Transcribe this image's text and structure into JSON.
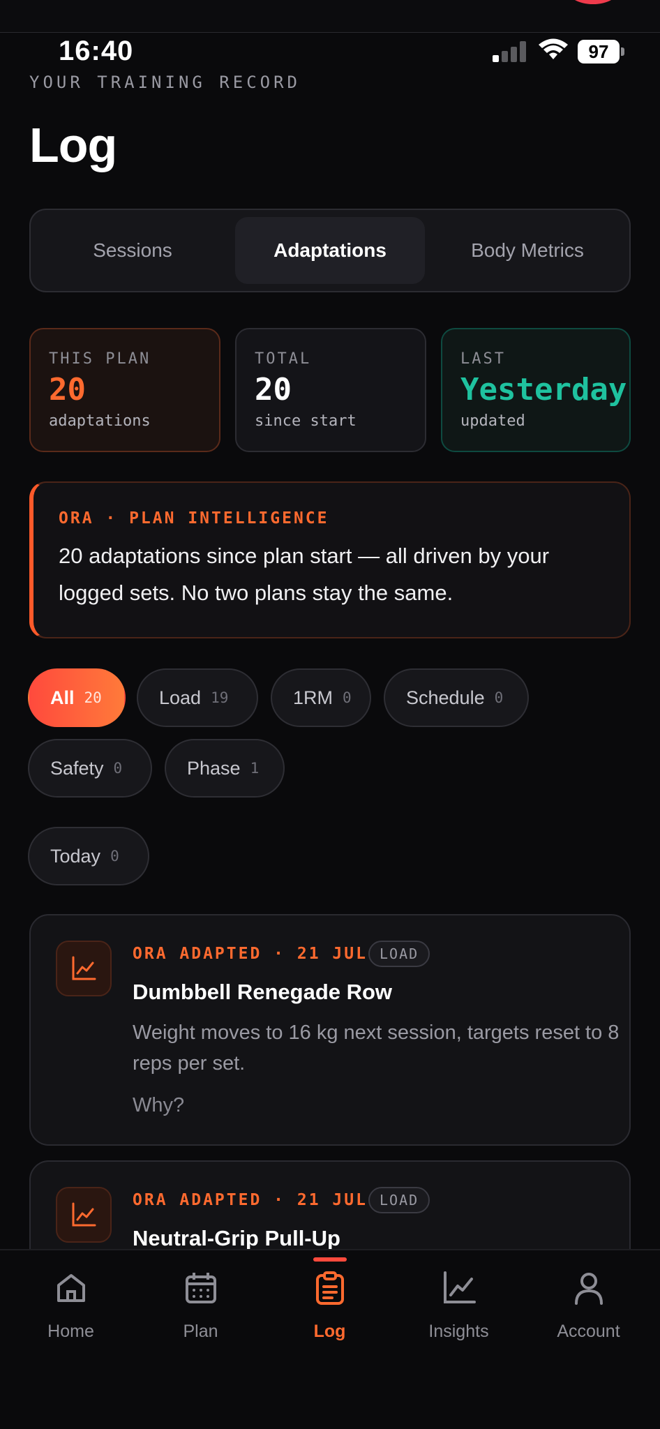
{
  "status_bar": {
    "time": "16:40",
    "battery": "97"
  },
  "header": {
    "kicker": "YOUR TRAINING RECORD",
    "title": "Log"
  },
  "tabs": [
    {
      "label": "Sessions",
      "active": false
    },
    {
      "label": "Adaptations",
      "active": true
    },
    {
      "label": "Body Metrics",
      "active": false
    }
  ],
  "stats": [
    {
      "label": "THIS PLAN",
      "value": "20",
      "sub": "adaptations"
    },
    {
      "label": "TOTAL",
      "value": "20",
      "sub": "since start"
    },
    {
      "label": "LAST",
      "value": "Yesterday",
      "sub": "updated"
    }
  ],
  "intel": {
    "tag": "ORA · PLAN INTELLIGENCE",
    "message": "20 adaptations since plan start — all driven by your logged sets. No two plans stay the same."
  },
  "filters": [
    {
      "label": "All",
      "count": "20",
      "active": true
    },
    {
      "label": "Load",
      "count": "19"
    },
    {
      "label": "1RM",
      "count": "0"
    },
    {
      "label": "Schedule",
      "count": "0"
    },
    {
      "label": "Safety",
      "count": "0"
    },
    {
      "label": "Phase",
      "count": "1"
    },
    {
      "label": "Today",
      "count": "0"
    }
  ],
  "cards": [
    {
      "meta": "ORA ADAPTED · 21 JUL",
      "badge": "LOAD",
      "title": "Dumbbell Renegade Row",
      "description": "Weight moves to 16 kg next session, targets reset to 8 reps per set.",
      "why": "Why?",
      "icon": "trend-chart-icon"
    },
    {
      "meta": "ORA ADAPTED · 21 JUL",
      "badge": "LOAD",
      "title": "Neutral-Grip Pull-Up",
      "icon": "trend-chart-icon"
    }
  ],
  "nav": [
    {
      "label": "Home",
      "icon": "home-icon"
    },
    {
      "label": "Plan",
      "icon": "calendar-icon"
    },
    {
      "label": "Log",
      "icon": "clipboard-icon",
      "active": true
    },
    {
      "label": "Insights",
      "icon": "chart-icon"
    },
    {
      "label": "Account",
      "icon": "user-icon"
    }
  ],
  "colors": {
    "accent": "#ff6a2f",
    "teal": "#1fc29f",
    "background": "#0a0a0c"
  }
}
